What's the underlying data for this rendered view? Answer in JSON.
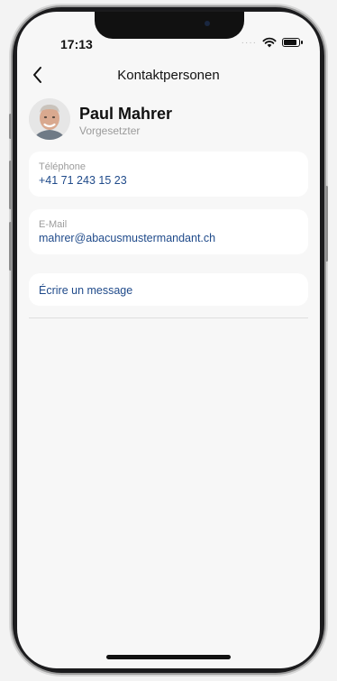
{
  "status_bar": {
    "time": "17:13"
  },
  "nav": {
    "title": "Kontaktpersonen"
  },
  "contact": {
    "name": "Paul Mahrer",
    "role": "Vorgesetzter"
  },
  "phone": {
    "label": "Téléphone",
    "value": "+41 71 243 15 23"
  },
  "email": {
    "label": "E-Mail",
    "value": "mahrer@abacusmustermandant.ch"
  },
  "message": {
    "label": "Écrire un message"
  },
  "colors": {
    "link": "#1f4a8a",
    "background": "#f7f7f7",
    "card": "#ffffff"
  }
}
